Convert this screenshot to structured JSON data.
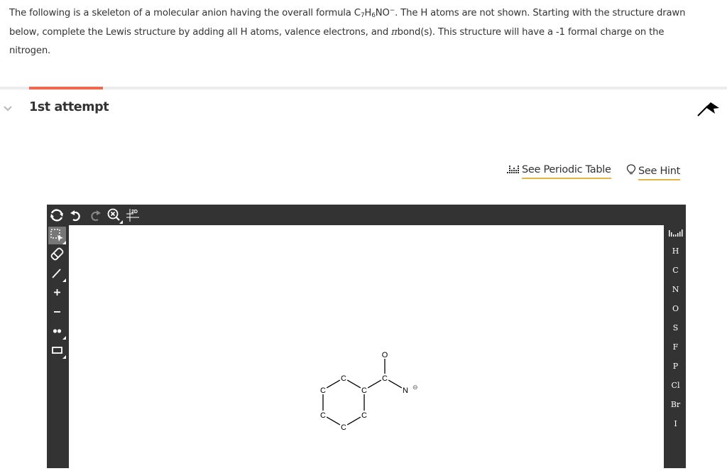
{
  "question": {
    "part1": "The following is a skeleton of a molecular anion having the overall formula C",
    "sub1": "7",
    "part2": "H",
    "sub2": "6",
    "part3": "NO",
    "sup1": "−",
    "part4": ". The H atoms are not shown. Starting with the structure drawn below, complete the Lewis structure by adding all H atoms, valence electrons, and ",
    "pi": "π",
    "part5": "bond(s). This structure will have a -1 formal charge on the nitrogen."
  },
  "attempt": {
    "title": "1st attempt"
  },
  "links": {
    "periodic_table": "See Periodic Table",
    "hint": "See Hint"
  },
  "colors": {
    "accent_tab": "#ee6a4f",
    "link_underline": "#e2b542",
    "editor_bg": "#333333"
  },
  "editor": {
    "top_tools": [
      "rotate-icon",
      "undo-icon",
      "redo-icon",
      "zoom-reset-icon",
      "2d-clean-icon"
    ],
    "left_tools": [
      "select-icon",
      "eraser-icon",
      "bond-icon",
      "positive-charge-icon",
      "negative-charge-icon",
      "lone-pair-icon",
      "ring-template-icon"
    ],
    "clean_label": "2D",
    "elements": [
      "H",
      "C",
      "N",
      "O",
      "S",
      "F",
      "P",
      "Cl",
      "Br",
      "I"
    ],
    "molecule": {
      "atoms": [
        {
          "id": "c1",
          "label": "C"
        },
        {
          "id": "c2",
          "label": "C"
        },
        {
          "id": "c3",
          "label": "C"
        },
        {
          "id": "c4",
          "label": "C"
        },
        {
          "id": "c5",
          "label": "C"
        },
        {
          "id": "c6",
          "label": "C"
        },
        {
          "id": "c7",
          "label": "C"
        },
        {
          "id": "o1",
          "label": "O"
        },
        {
          "id": "n1",
          "label": "N",
          "charge": "⊖"
        }
      ],
      "bonds": [
        [
          "c1",
          "c2"
        ],
        [
          "c2",
          "c3"
        ],
        [
          "c3",
          "c4"
        ],
        [
          "c4",
          "c5"
        ],
        [
          "c5",
          "c6"
        ],
        [
          "c6",
          "c1"
        ],
        [
          "c6",
          "c7"
        ],
        [
          "c7",
          "o1"
        ],
        [
          "c7",
          "n1"
        ]
      ]
    }
  }
}
